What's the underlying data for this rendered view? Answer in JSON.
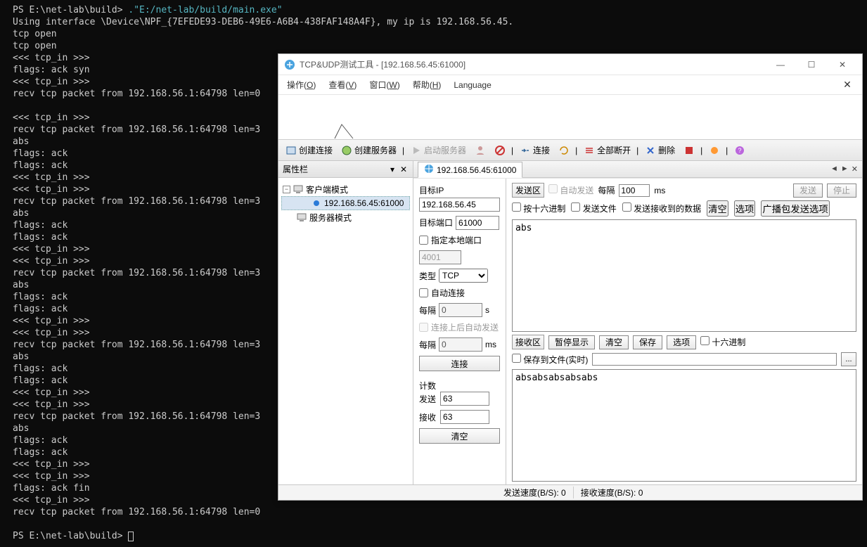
{
  "terminal": {
    "prompt1": "PS E:\\net-lab\\build> ",
    "cmd": ".\"E:/net-lab/build/main.exe\"",
    "lines": [
      "Using interface \\Device\\NPF_{7EFEDE93-DEB6-49E6-A6B4-438FAF148A4F}, my ip is 192.168.56.45.",
      "tcp open",
      "tcp open",
      "<<< tcp_in >>>",
      "flags: ack syn",
      "<<< tcp_in >>>",
      "recv tcp packet from 192.168.56.1:64798 len=0",
      "",
      "<<< tcp_in >>>",
      "recv tcp packet from 192.168.56.1:64798 len=3",
      "abs",
      "flags: ack",
      "flags: ack",
      "<<< tcp_in >>>",
      "<<< tcp_in >>>",
      "recv tcp packet from 192.168.56.1:64798 len=3",
      "abs",
      "flags: ack",
      "flags: ack",
      "<<< tcp_in >>>",
      "<<< tcp_in >>>",
      "recv tcp packet from 192.168.56.1:64798 len=3",
      "abs",
      "flags: ack",
      "flags: ack",
      "<<< tcp_in >>>",
      "<<< tcp_in >>>",
      "recv tcp packet from 192.168.56.1:64798 len=3",
      "abs",
      "flags: ack",
      "flags: ack",
      "<<< tcp_in >>>",
      "<<< tcp_in >>>",
      "recv tcp packet from 192.168.56.1:64798 len=3",
      "abs",
      "flags: ack",
      "flags: ack",
      "<<< tcp_in >>>",
      "<<< tcp_in >>>",
      "flags: ack fin",
      "<<< tcp_in >>>",
      "recv tcp packet from 192.168.56.1:64798 len=0",
      ""
    ],
    "prompt2": "PS E:\\net-lab\\build> "
  },
  "win": {
    "title": "TCP&UDP测试工具 - [192.168.56.45:61000]",
    "menu": {
      "op": "操作(O)",
      "view": "查看(V)",
      "window": "窗口(W)",
      "help": "帮助(H)",
      "lang": "Language"
    },
    "toolbar": {
      "create_conn": "创建连接",
      "create_srv": "创建服务器",
      "start_srv": "启动服务器",
      "connect": "连接",
      "disconnect_all": "全部断开",
      "delete": "删除"
    },
    "prop": {
      "title": "属性栏",
      "client_mode": "客户端模式",
      "node": "192.168.56.45:61000",
      "server_mode": "服务器模式"
    },
    "tab": {
      "label": "192.168.56.45:61000"
    },
    "conn": {
      "dest_ip_label": "目标IP",
      "dest_ip": "192.168.56.45",
      "dest_port_label": "目标端口",
      "dest_port": "61000",
      "local_port_label": "指定本地端口",
      "local_port": "4001",
      "type_label": "类型",
      "type": "TCP",
      "auto_conn": "自动连接",
      "interval_label": "每隔",
      "interval_val": "0",
      "interval_unit_s": "s",
      "auto_send_after": "连接上后自动发送",
      "interval2_val": "0",
      "interval_unit_ms": "ms",
      "connect_btn": "连接",
      "counts_label": "计数",
      "send_label": "发送",
      "send_count": "63",
      "recv_label": "接收",
      "recv_count": "63",
      "clear_btn": "清空"
    },
    "send": {
      "area_label": "发送区",
      "auto_send": "自动发送",
      "interval_label": "每隔",
      "interval": "100",
      "unit": "ms",
      "send_btn": "发送",
      "stop_btn": "停止",
      "hex": "按十六进制",
      "send_file": "发送文件",
      "send_recv_data": "发送接收到的数据",
      "clear_btn": "清空",
      "opts_btn": "选项",
      "broadcast_btn": "广播包发送选项",
      "text": "abs"
    },
    "recv": {
      "area_label": "接收区",
      "pause_btn": "暂停显示",
      "clear_btn": "清空",
      "save_btn": "保存",
      "opts_btn": "选项",
      "hex": "十六进制",
      "save_file": "保存到文件(实时)",
      "browse": "...",
      "text": "absabsabsabsabs"
    },
    "status": {
      "send_speed": "发送速度(B/S): 0",
      "recv_speed": "接收速度(B/S): 0"
    }
  }
}
